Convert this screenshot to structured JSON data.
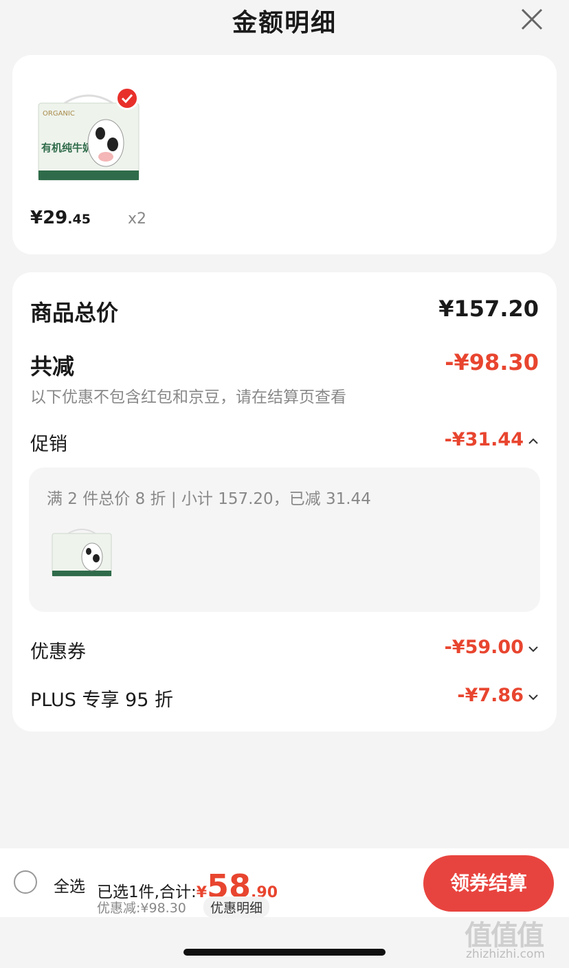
{
  "header": {
    "title": "金额明细"
  },
  "item": {
    "price_int": "¥29",
    "price_dec": ".45",
    "qty": "x2",
    "brand_text": "ORGANIC",
    "product_text": "有机纯牛奶"
  },
  "summary": {
    "total_label": "商品总价",
    "total_value": "¥157.20",
    "reduce_label": "共减",
    "reduce_value": "-¥98.30",
    "note": "以下优惠不包含红包和京豆，请在结算页查看",
    "promo_label": "促销",
    "promo_value": "-¥31.44",
    "promo_detail": "满 2 件总价 8 折 | 小计 157.20，已减 31.44",
    "coupon_label": "优惠券",
    "coupon_value": "-¥59.00",
    "plus_label": "PLUS 专享 95 折",
    "plus_value": "-¥7.86"
  },
  "footer": {
    "select_all": "全选",
    "selected_info": "已选1件,合计:",
    "currency": "¥",
    "amount_int": "58",
    "amount_dec": ".90",
    "discount": "优惠减:¥98.30",
    "detail_tag": "优惠明细",
    "pay_button": "领券结算"
  },
  "watermark": {
    "main": "值值值",
    "sub": "zhizhizhi.com"
  },
  "icons": {
    "close": "close-icon",
    "check": "check-icon",
    "chevron_up": "chevron-up-icon",
    "chevron_down": "chevron-down-icon",
    "radio": "radio-unchecked-icon"
  },
  "colors": {
    "accent": "#e8452f",
    "pay_button": "#e8443f"
  }
}
